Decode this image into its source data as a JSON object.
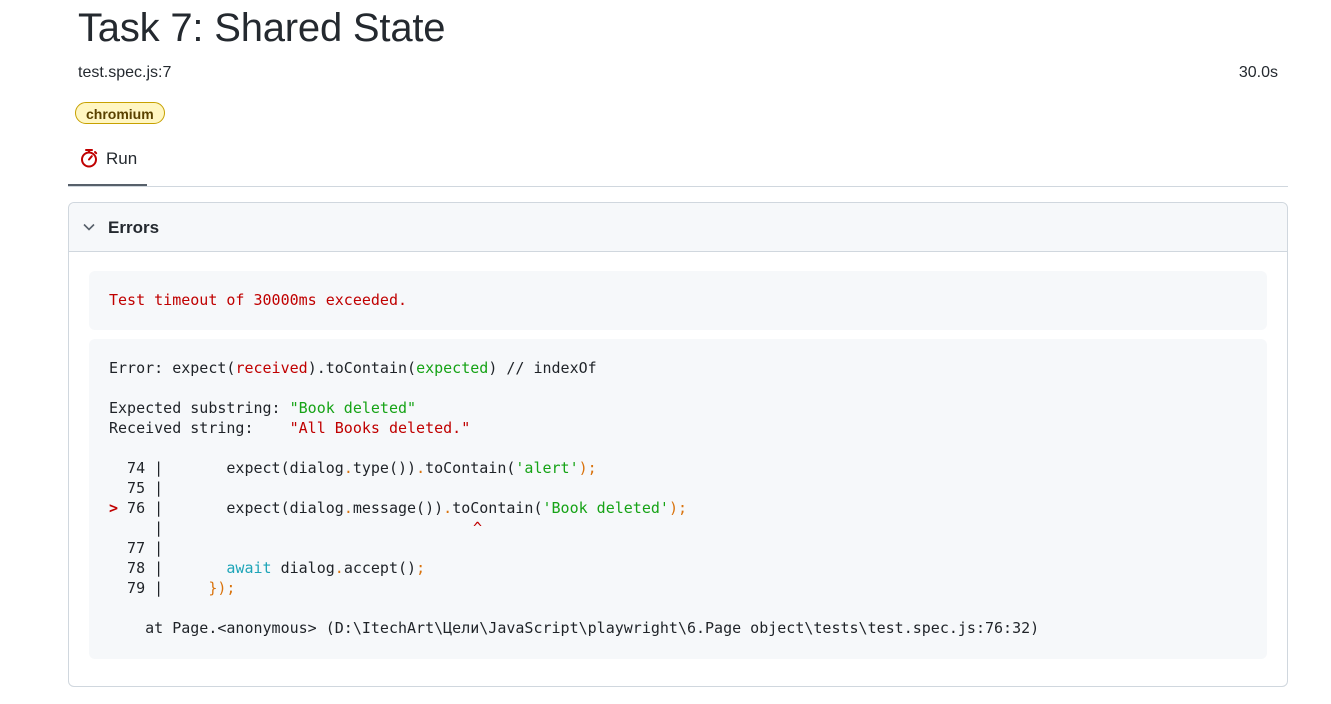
{
  "header": {
    "title": "Task 7: Shared State",
    "file": "test.spec.js:7",
    "duration": "30.0s",
    "badge": "chromium"
  },
  "tabs": [
    {
      "label": "Run",
      "icon": "stopwatch-icon",
      "active": true
    }
  ],
  "errors_panel": {
    "title": "Errors",
    "timeout_message": "Test timeout of 30000ms exceeded.",
    "error": {
      "l1_prefix": "Error: expect(",
      "l1_received": "received",
      "l1_mid": ").toContain(",
      "l1_expected": "expected",
      "l1_suffix": ") // indexOf",
      "expected_label": "Expected substring: ",
      "expected_value": "\"Book deleted\"",
      "received_label": "Received string:    ",
      "received_value": "\"All Books deleted.\""
    },
    "code": {
      "l74_num": "  74 |",
      "l74_a": "       expect(dialog",
      "l74_b": ".",
      "l74_c": "type())",
      "l74_d": ".",
      "l74_e": "toContain(",
      "l74_f": "'alert'",
      "l74_g": ");",
      "l75_num": "  75 |",
      "l76_marker": ">",
      "l76_num": " 76 |",
      "l76_a": "       expect(dialog",
      "l76_b": ".",
      "l76_c": "message())",
      "l76_d": ".",
      "l76_e": "toContain(",
      "l76_f": "'Book deleted'",
      "l76_g": ");",
      "caret_bar": "     |",
      "caret": "^",
      "l77_num": "  77 |",
      "l78_num": "  78 |",
      "l78_a": "await",
      "l78_b": " dialog",
      "l78_c": ".",
      "l78_d": "accept()",
      "l78_e": ";",
      "l79_num": "  79 |",
      "l79_a": "     });",
      "stack": "    at Page.<anonymous> (D:\\ItechArt\\Цели\\JavaScript\\playwright\\6.Page object\\tests\\test.spec.js:76:32)"
    }
  },
  "colors": {
    "error_red": "#c00000",
    "string_green": "#16a316",
    "keyword_cyan": "#1ea5b8",
    "punct_orange": "#d9730d",
    "badge_bg": "#fff6c2"
  }
}
